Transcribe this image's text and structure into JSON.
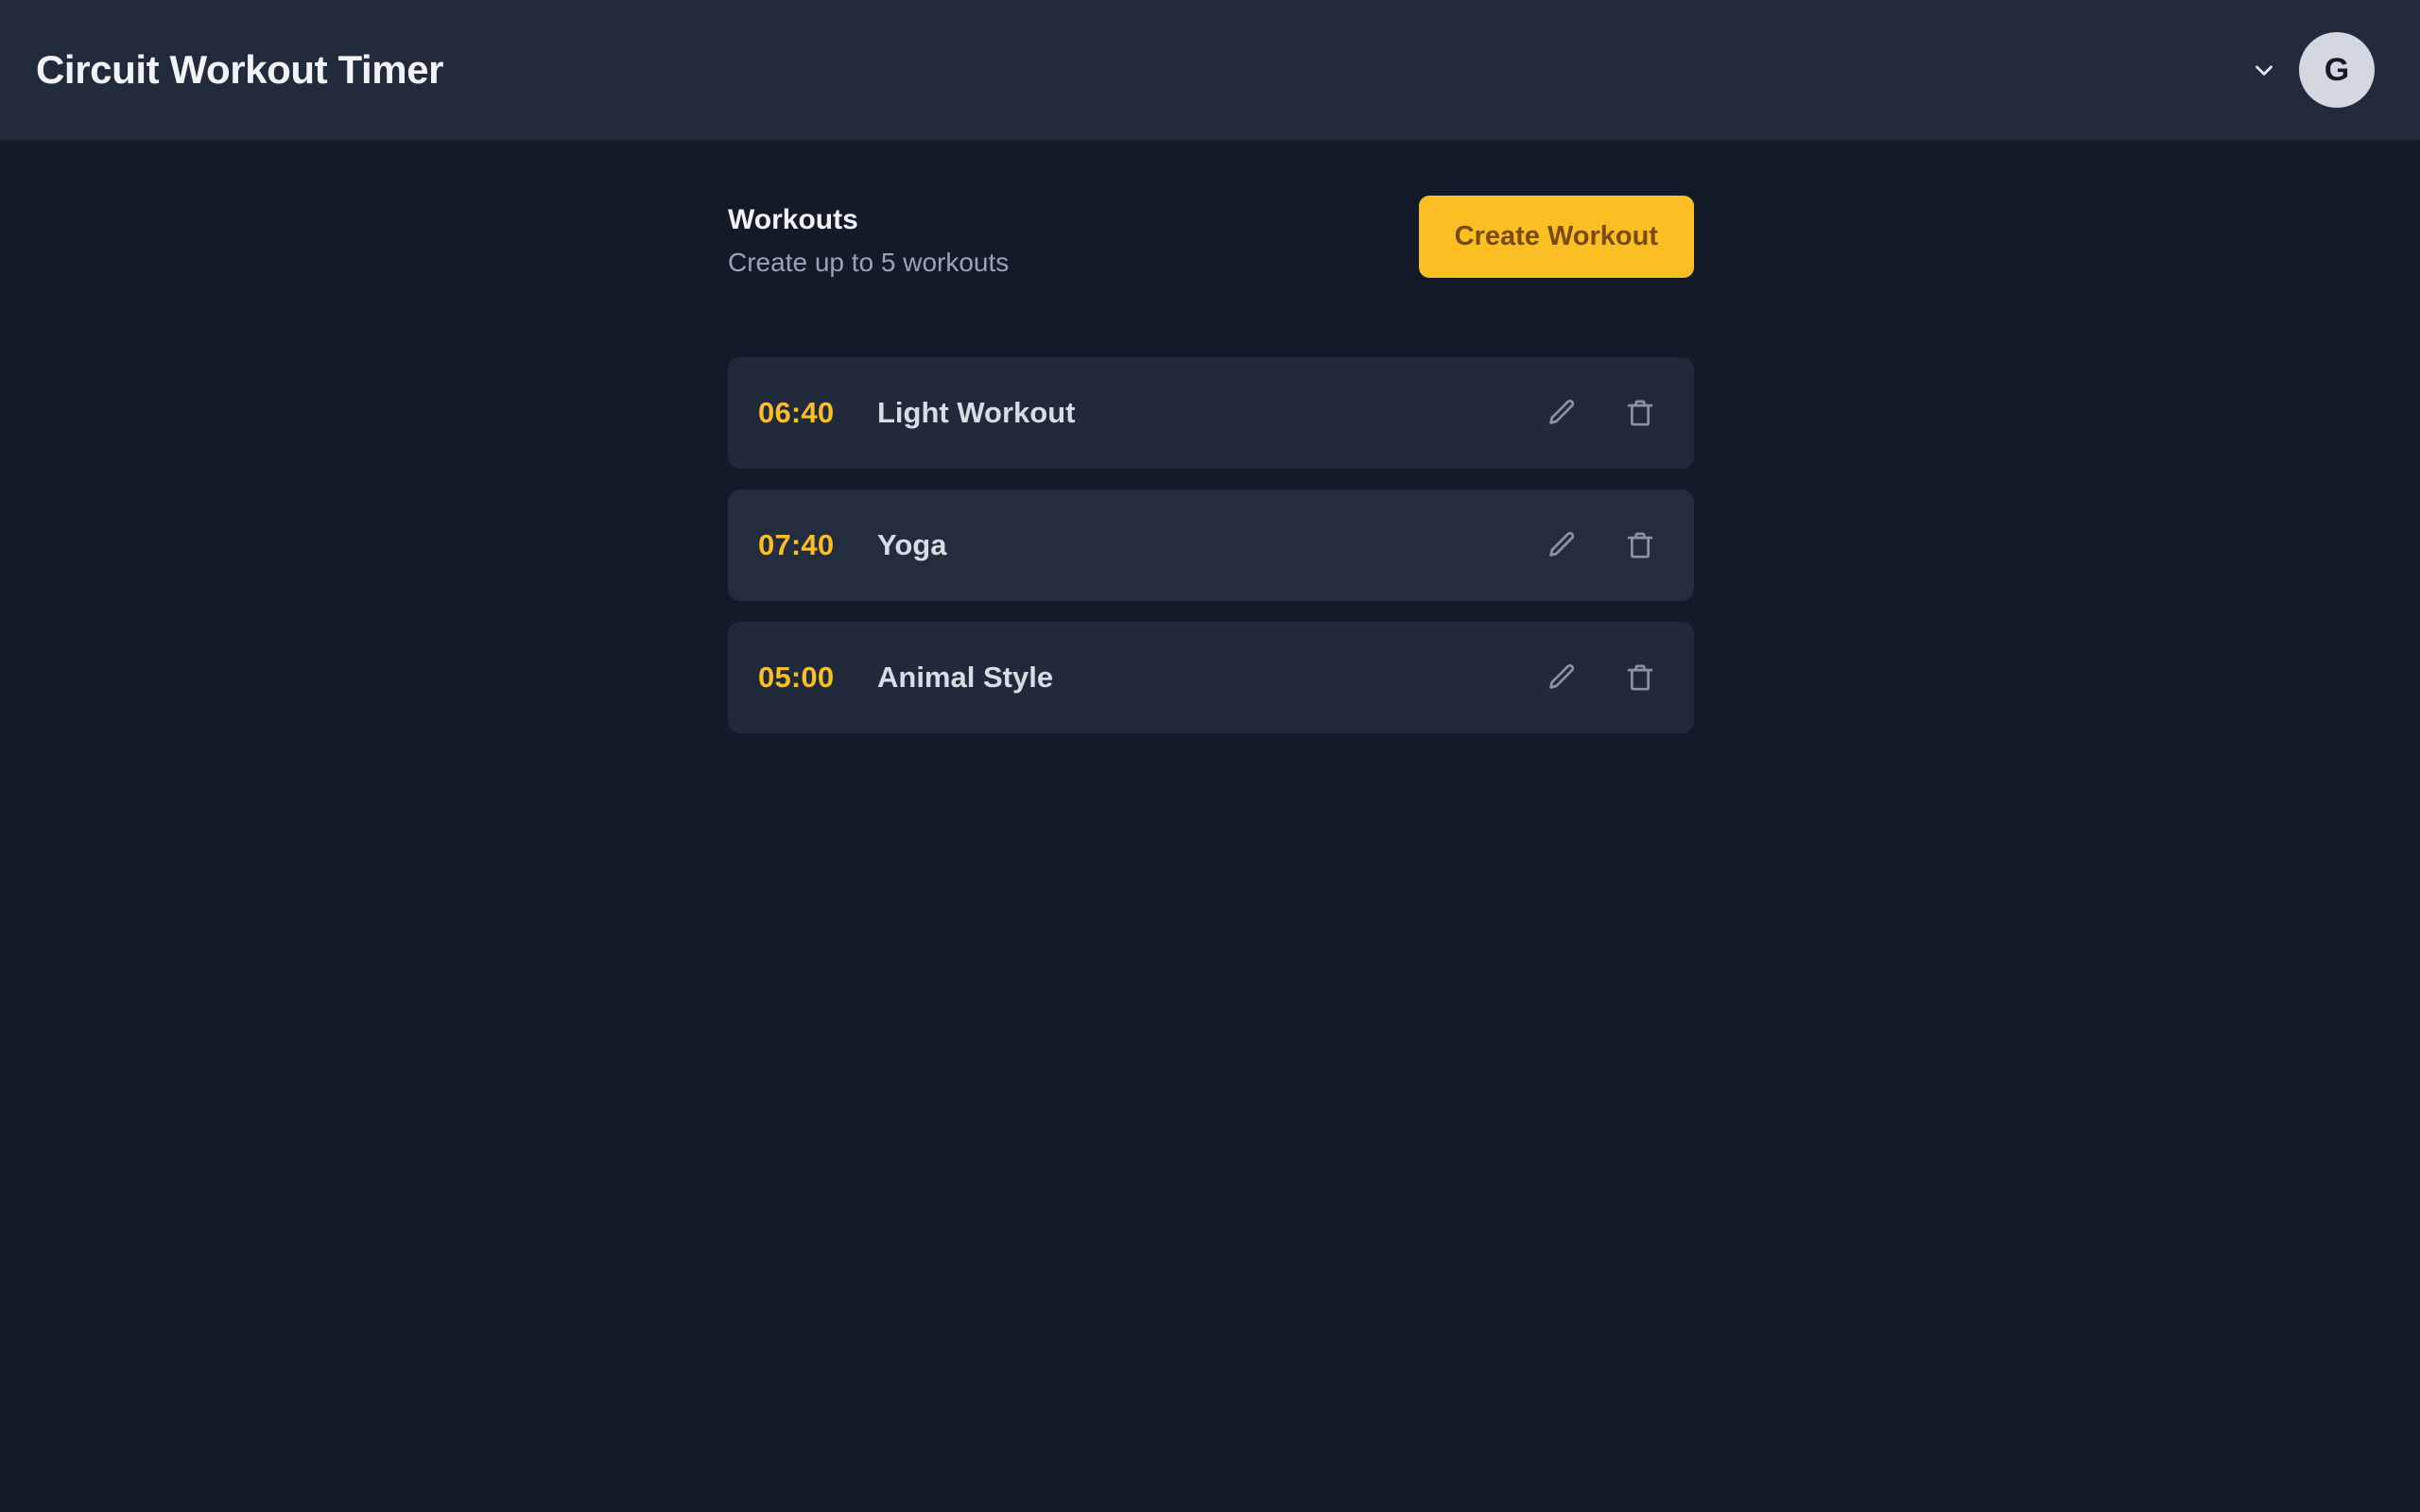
{
  "header": {
    "title": "Circuit Workout Timer",
    "chevron_icon": "chevron-down-icon",
    "avatar_initial": "G"
  },
  "main": {
    "section": {
      "heading": "Workouts",
      "subtitle": "Create up to 5 workouts",
      "create_button_label": "Create Workout"
    },
    "workouts": [
      {
        "time": "06:40",
        "name": "Light Workout",
        "edit_icon": "pencil-icon",
        "delete_icon": "trash-icon",
        "hovered": false
      },
      {
        "time": "07:40",
        "name": "Yoga",
        "edit_icon": "pencil-icon",
        "delete_icon": "trash-icon",
        "hovered": true
      },
      {
        "time": "05:00",
        "name": "Animal Style",
        "edit_icon": "pencil-icon",
        "delete_icon": "trash-icon",
        "hovered": false
      }
    ]
  },
  "colors": {
    "page_background": "#131A28",
    "header_background": "#212B3B",
    "card_background": "#212A3A",
    "card_background_hover": "#232D3E",
    "accent_amber": "#FBBF24",
    "accent_amber_text": "#7A4A10",
    "text_primary": "#F1F3F7",
    "text_secondary": "#9AA4B5",
    "text_row_label": "#D8DCE4",
    "icon_muted": "#8A94A6",
    "avatar_background": "#D3D7E0"
  }
}
